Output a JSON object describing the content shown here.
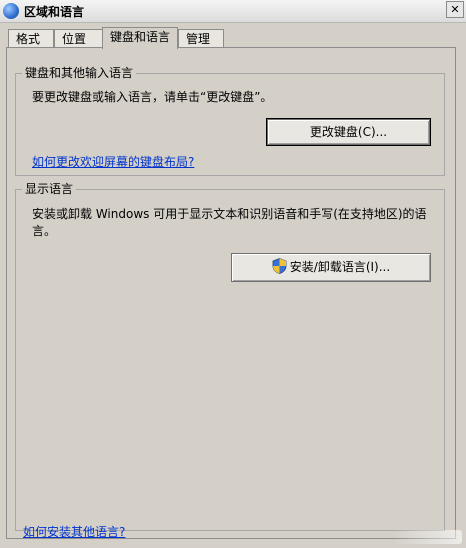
{
  "window": {
    "title": "区域和语言",
    "close_label": "✕"
  },
  "tabs": [
    {
      "label": "格式"
    },
    {
      "label": "位置"
    },
    {
      "label": "键盘和语言"
    },
    {
      "label": "管理"
    }
  ],
  "keyboard_group": {
    "title": "键盘和其他输入语言",
    "description": "要更改键盘或输入语言，请单击“更改键盘”。",
    "button_label": "更改键盘(C)...",
    "link": "如何更改欢迎屏幕的键盘布局?"
  },
  "display_group": {
    "title": "显示语言",
    "description": "安装或卸载 Windows 可用于显示文本和识别语音和手写(在支持地区)的语言。",
    "button_label": "安装/卸载语言(I)..."
  },
  "footer_link": "如何安装其他语言?",
  "colors": {
    "link": "#0033cc",
    "background": "#d4d0c8"
  }
}
